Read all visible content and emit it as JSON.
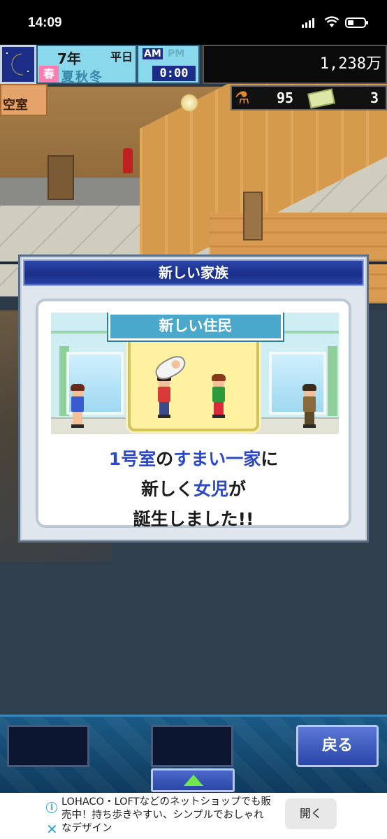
{
  "status_bar": {
    "time": "14:09"
  },
  "hud": {
    "year": "7年",
    "day": "平日",
    "season": "春",
    "season_row": "夏秋冬",
    "am": "AM",
    "pm": "PM",
    "clock": "0:00",
    "money": "1,238万",
    "room_label": "空室",
    "research_points": "95",
    "tickets": "3"
  },
  "dialog": {
    "title": "新しい家族",
    "scene_label": "新しい住民",
    "message_line1_a": "1号室",
    "message_line1_b": "の",
    "message_line1_c": "すまい一家",
    "message_line1_d": "に",
    "message_line2_a": "新しく",
    "message_line2_b": "女児",
    "message_line2_c": "が",
    "message_line3": "誕生しました!!"
  },
  "toolbar": {
    "back_label": "戻る"
  },
  "ad": {
    "text": "LOHACO・LOFTなどのネットショップでも販売中！持ち歩きやすい、シンプルでおしゃれなデザイン",
    "button_label": "開く"
  },
  "colors": {
    "accent_blue": "#2a48c8",
    "dialog_header": "#1a2e8a",
    "label_teal": "#4aa8cc"
  }
}
